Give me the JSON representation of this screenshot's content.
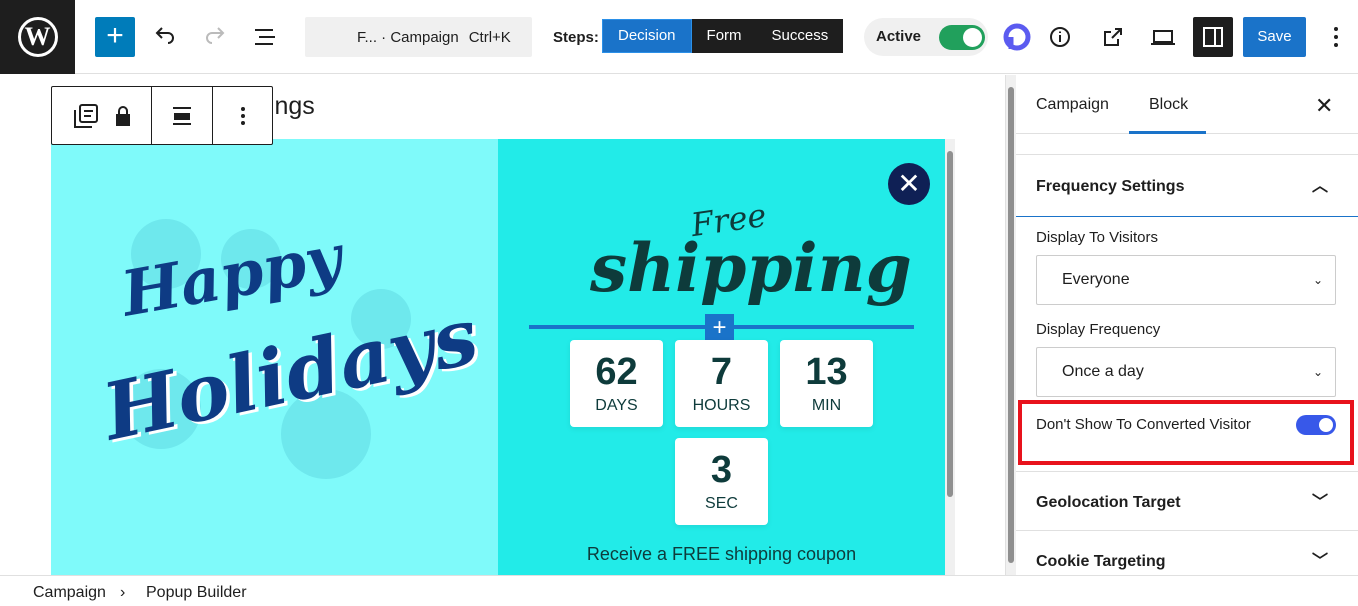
{
  "header": {
    "command_text": "F... · Campaign",
    "command_shortcut": "Ctrl+K",
    "steps_label": "Steps:",
    "steps": [
      "Decision",
      "Form",
      "Success"
    ],
    "active_step": "Decision",
    "status_label": "Active",
    "status_on": true,
    "save_label": "Save"
  },
  "editor": {
    "heading_fragment": "ttings",
    "popup": {
      "left_line1": "Happy",
      "left_line2": "Holidays",
      "free": "Free",
      "shipping": "shipping",
      "countdown": [
        {
          "value": "62",
          "unit": "DAYS"
        },
        {
          "value": "7",
          "unit": "HOURS"
        },
        {
          "value": "13",
          "unit": "MIN"
        },
        {
          "value": "3",
          "unit": "SEC"
        }
      ],
      "coupon_text": "Receive a FREE shipping coupon"
    }
  },
  "panel": {
    "tabs": [
      "Campaign",
      "Block"
    ],
    "active_tab": "Block",
    "frequency_title": "Frequency Settings",
    "display_to_label": "Display To Visitors",
    "display_to_value": "Everyone",
    "display_freq_label": "Display Frequency",
    "display_freq_value": "Once a day",
    "dont_show_label": "Don't Show To Converted Visitor",
    "dont_show_on": true,
    "geo_title": "Geolocation Target",
    "cookie_title": "Cookie Targeting"
  },
  "breadcrumbs": [
    "Campaign",
    "Popup Builder"
  ],
  "colors": {
    "accent": "#1a73c9",
    "toggle_green": "#21a05c",
    "toggle_blue": "#3858e9",
    "highlight": "#e8121c",
    "popup_left_bg": "#7ffafa",
    "popup_right_bg": "#22ebe8"
  }
}
